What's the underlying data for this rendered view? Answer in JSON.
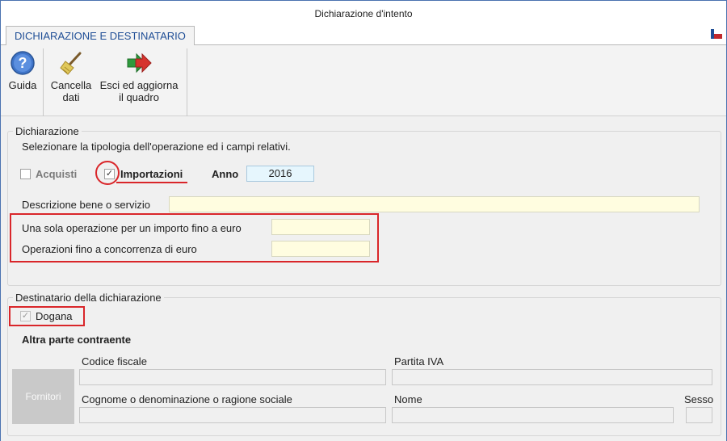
{
  "window": {
    "title": "Dichiarazione d'intento"
  },
  "tabs": [
    {
      "label": "DICHIARAZIONE E DESTINATARIO"
    }
  ],
  "toolbar": {
    "guida_label": "Guida",
    "cancella_label_1": "Cancella",
    "cancella_label_2": "dati",
    "esci_label_1": "Esci ed aggiorna",
    "esci_label_2": "il quadro"
  },
  "dichiarazione": {
    "legend": "Dichiarazione",
    "instruction": "Selezionare la tipologia dell'operazione ed i campi relativi.",
    "acquisti_label": "Acquisti",
    "acquisti_checked": false,
    "importazioni_label": "Importazioni",
    "importazioni_checked": true,
    "anno_label": "Anno",
    "anno_value": "2016",
    "descrizione_label": "Descrizione bene o servizio",
    "descrizione_value": "",
    "sola_operazione_label": "Una sola operazione per un importo fino a euro",
    "sola_operazione_value": "",
    "concorrenza_label": "Operazioni fino a concorrenza di euro",
    "concorrenza_value": ""
  },
  "destinatario": {
    "legend": "Destinatario della dichiarazione",
    "dogana_label": "Dogana",
    "dogana_checked": true,
    "altra_parte_label": "Altra parte contraente",
    "fornitori_label": "Fornitori",
    "codice_fiscale_label": "Codice fiscale",
    "partita_iva_label": "Partita IVA",
    "cognome_label": "Cognome o denominazione o ragione sociale",
    "nome_label": "Nome",
    "sesso_label": "Sesso"
  },
  "colors": {
    "accent_red": "#d9262a",
    "tab_text": "#1f4e96",
    "field_yellow": "#fffde0",
    "field_blue": "#e6f6fd"
  },
  "icons": {
    "help": "help-icon",
    "broom": "broom-icon",
    "exit_arrow": "exit-arrow-icon",
    "flag": "flag-icon"
  }
}
